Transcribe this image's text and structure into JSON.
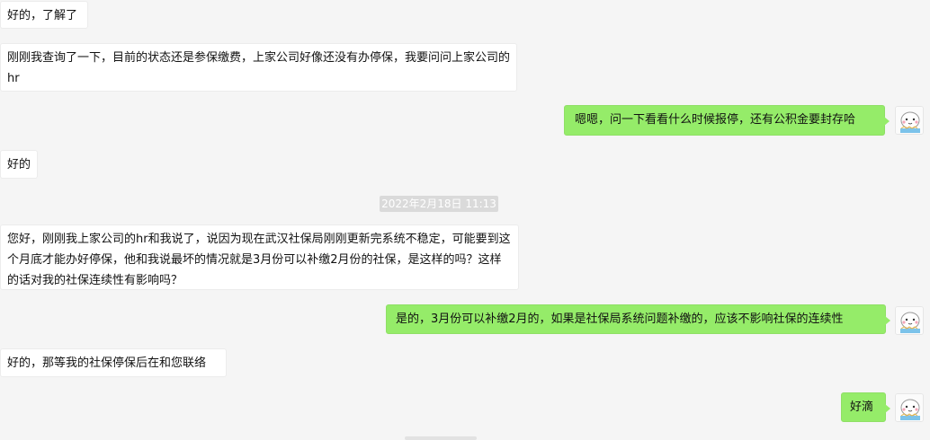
{
  "messages": [
    {
      "side": "in",
      "text": "好的，了解了"
    },
    {
      "side": "in",
      "text": "刚刚我查询了一下，目前的状态还是参保缴费，上家公司好像还没有办停保，我要问问上家公司的hr"
    },
    {
      "side": "out",
      "text": "嗯嗯，问一下看看什么时候报停，还有公积金要封存哈"
    },
    {
      "side": "in",
      "text": "好的"
    },
    {
      "side": "in",
      "text": "您好，刚刚我上家公司的hr和我说了，说因为现在武汉社保局刚刚更新完系统不稳定，可能要到这个月底才能办好停保，他和我说最坏的情况就是3月份可以补缴2月份的社保，是这样的吗？这样的话对我的社保连续性有影响吗？"
    },
    {
      "side": "out",
      "text": "是的，3月份可以补缴2月的，如果是社保局系统问题补缴的，应该不影响社保的连续性"
    },
    {
      "side": "in",
      "text": "好的，那等我的社保停保后在和您联络"
    },
    {
      "side": "out",
      "text": "好滴"
    }
  ],
  "timestamp": "2022年2月18日 11:13",
  "avatar_icon": "cartoon-avatar-icon",
  "colors": {
    "background": "#f5f5f5",
    "incoming_bubble": "#ffffff",
    "outgoing_bubble": "#95ec69",
    "timestamp_bg": "#dadada"
  }
}
